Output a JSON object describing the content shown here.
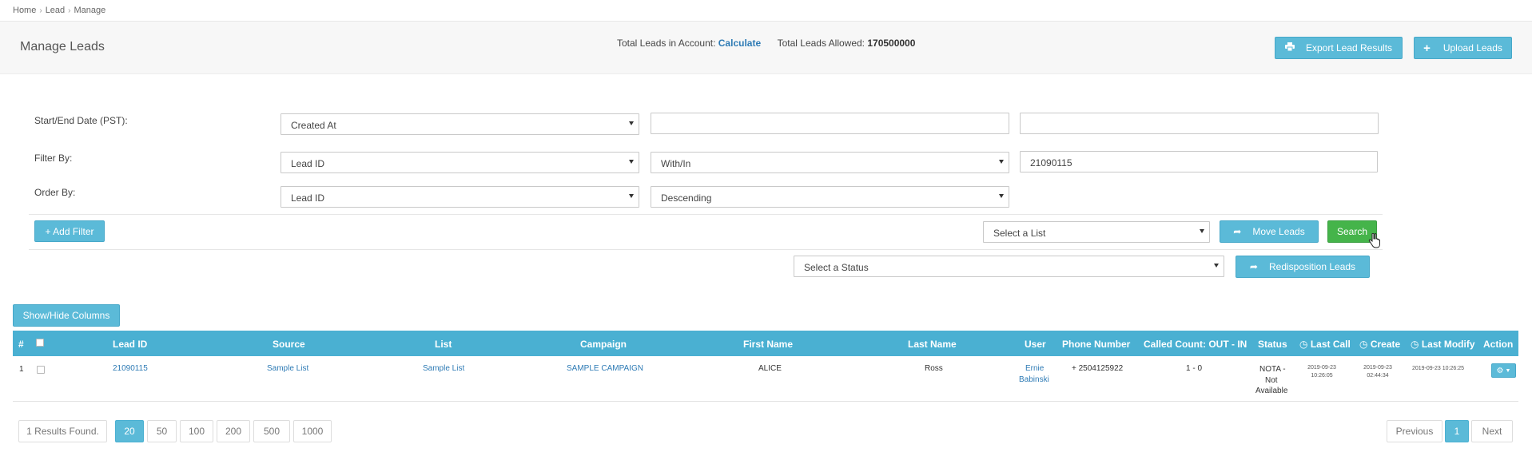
{
  "breadcrumb": {
    "home": "Home",
    "lead": "Lead",
    "current": "Manage"
  },
  "header": {
    "title": "Manage Leads",
    "total_leads_label": "Total Leads in Account:",
    "calculate_link": "Calculate",
    "allowed_label": "Total Leads Allowed:",
    "allowed_value": "170500000",
    "export_button": "Export Lead Results",
    "upload_button": "Upload Leads"
  },
  "filters": {
    "date_label": "Start/End Date (PST):",
    "date_field_select": "Created At",
    "start_date_value": "",
    "end_date_value": "",
    "filter_label": "Filter By:",
    "filter_field_select": "Lead ID",
    "filter_operator_select": "With/In",
    "filter_value": "21090115",
    "order_label": "Order By:",
    "order_field_select": "Lead ID",
    "order_direction_select": "Descending",
    "add_filter_button": "+ Add Filter",
    "list_select": "Select a List",
    "move_leads_button": "Move Leads",
    "search_button": "Search",
    "status_select": "Select a Status",
    "redisposition_button": "Redisposition Leads"
  },
  "table": {
    "show_hide_button": "Show/Hide Columns",
    "headers": {
      "num": "#",
      "lead_id": "Lead ID",
      "source": "Source",
      "list": "List",
      "campaign": "Campaign",
      "first_name": "First Name",
      "last_name": "Last Name",
      "user": "User",
      "phone": "Phone Number",
      "called_count": "Called Count: OUT - IN",
      "status": "Status",
      "last_call": "Last Call",
      "create": "Create",
      "last_modify": "Last Modify",
      "action": "Action"
    },
    "rows": [
      {
        "num": "1",
        "lead_id": "21090115",
        "source": "Sample List",
        "list": "Sample List",
        "campaign": "SAMPLE CAMPAIGN",
        "first_name": "ALICE",
        "last_name": "Ross",
        "user_first": "Ernie",
        "user_last": "Babinski",
        "phone": "+ 2504125922",
        "called_count": "1 - 0",
        "status_1": "NOTA -",
        "status_2": "Not",
        "status_3": "Available",
        "last_call_date": "2019-09-23",
        "last_call_time": "10:26:05",
        "create_date": "2019-09-23",
        "create_time": "02:44:34",
        "last_modify": "2019-09-23 10:26:25"
      }
    ]
  },
  "pagination": {
    "results_found": "1 Results Found.",
    "page_sizes": [
      "20",
      "50",
      "100",
      "200",
      "500",
      "1000"
    ],
    "active_page_size": "20",
    "previous": "Previous",
    "current_page": "1",
    "next": "Next"
  },
  "colors": {
    "info": "#5bbad8",
    "table_header": "#4ab0d2",
    "success": "#45b44a",
    "link": "#2e7bb5"
  }
}
